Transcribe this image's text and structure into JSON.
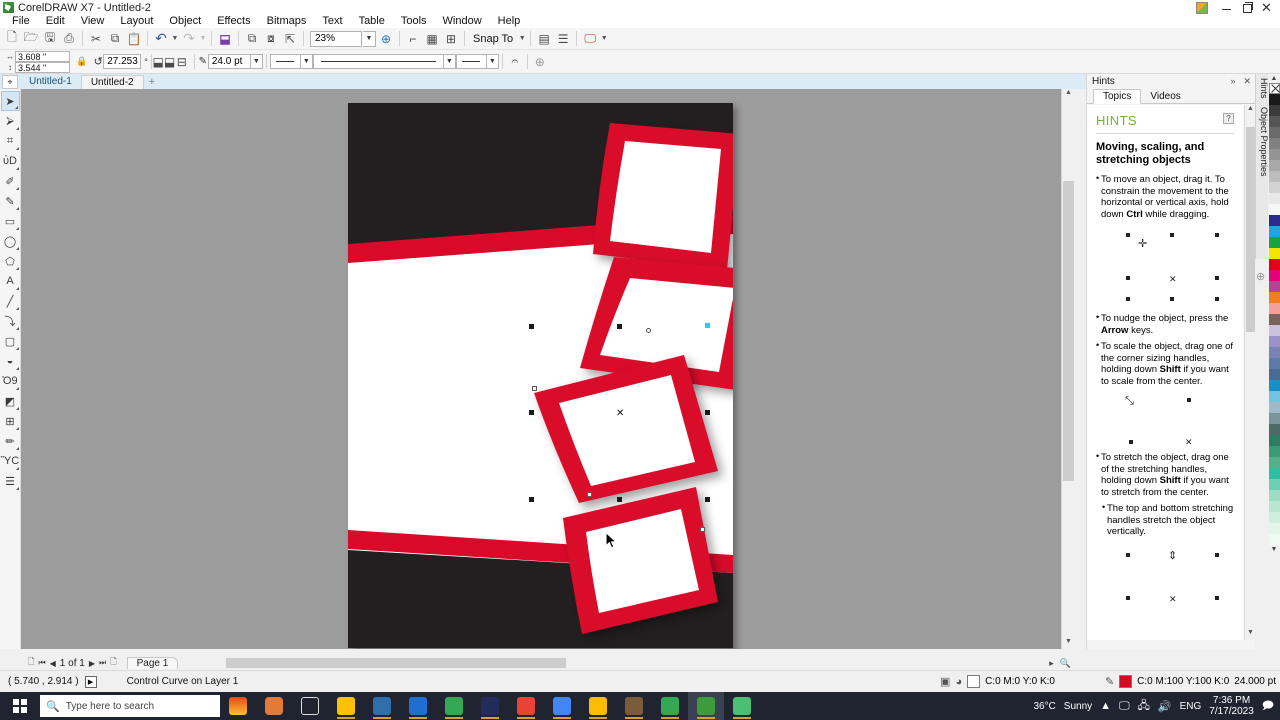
{
  "window": {
    "title": "CorelDRAW X7 - Untitled-2",
    "app_icon": "coreldraw-icon",
    "minimize": "–",
    "maximize": "❐",
    "close": "✕"
  },
  "menubar": {
    "items": [
      "File",
      "Edit",
      "View",
      "Layout",
      "Object",
      "Effects",
      "Bitmaps",
      "Text",
      "Table",
      "Tools",
      "Window",
      "Help"
    ]
  },
  "toolbar": {
    "zoom_level": "23%",
    "snap_to_label": "Snap To",
    "buttons": [
      {
        "name": "new-document",
        "glyph": "὜B"
      },
      {
        "name": "open-document",
        "glyph": "὜1"
      },
      {
        "name": "save-document",
        "glyph": "ὋE"
      },
      {
        "name": "print",
        "glyph": "⎙"
      },
      {
        "name": "cut",
        "glyph": "✂"
      },
      {
        "name": "copy",
        "glyph": "⧉"
      },
      {
        "name": "paste",
        "glyph": "ὌB"
      },
      {
        "name": "undo",
        "glyph": "↶"
      },
      {
        "name": "redo",
        "glyph": "↷"
      },
      {
        "name": "import",
        "glyph": "⬇"
      },
      {
        "name": "export",
        "glyph": "⬆"
      },
      {
        "name": "publish-pdf",
        "glyph": "⧉"
      },
      {
        "name": "application-launcher",
        "glyph": "⊕"
      },
      {
        "name": "full-screen-preview",
        "glyph": "⌷"
      },
      {
        "name": "show-rulers",
        "glyph": "▤"
      },
      {
        "name": "show-grid",
        "glyph": "⊞"
      },
      {
        "name": "options",
        "glyph": "⚙"
      }
    ]
  },
  "propertybar": {
    "width_value": "3.608 \"",
    "height_value": "3.544 \"",
    "lock_ratio_icon": "lock-icon",
    "rotation_value": "27.253",
    "rotation_unit": "°",
    "outline_width_value": "24.0 pt",
    "mirror_h_icon": "mirror-horizontal-icon",
    "mirror_v_icon": "mirror-vertical-icon",
    "outline_icon": "outline-pen-icon",
    "wrap_text_icon": "wrap-text-icon",
    "edit_bitmap_icon": "edit-bitmap-icon"
  },
  "doc_tabs": {
    "tabs": [
      {
        "label": "Untitled-1",
        "active": false
      },
      {
        "label": "Untitled-2",
        "active": true
      }
    ],
    "add_label": "+"
  },
  "toolbox": {
    "tools": [
      {
        "name": "pick-tool",
        "glyph": "➤",
        "selected": true
      },
      {
        "name": "shape-tool",
        "glyph": "⮚",
        "selected": false
      },
      {
        "name": "crop-tool",
        "glyph": "⌗",
        "selected": false
      },
      {
        "name": "zoom-tool",
        "glyph": "ὐD",
        "selected": false
      },
      {
        "name": "freehand-tool",
        "glyph": "✐",
        "selected": false
      },
      {
        "name": "smart-fill-tool",
        "glyph": "✎",
        "selected": false
      },
      {
        "name": "rectangle-tool",
        "glyph": "▭",
        "selected": false
      },
      {
        "name": "ellipse-tool",
        "glyph": "◯",
        "selected": false
      },
      {
        "name": "polygon-tool",
        "glyph": "⬠",
        "selected": false
      },
      {
        "name": "text-tool",
        "glyph": "A",
        "selected": false
      },
      {
        "name": "parallel-dimension-tool",
        "glyph": "╱",
        "selected": false
      },
      {
        "name": "straight-line-connector-tool",
        "glyph": "⤵",
        "selected": false
      },
      {
        "name": "drop-shadow-tool",
        "glyph": "▢",
        "selected": false
      },
      {
        "name": "transparency-tool",
        "glyph": "◒",
        "selected": false
      },
      {
        "name": "color-eyedropper-tool",
        "glyph": "Ὀ9",
        "selected": false
      },
      {
        "name": "interactive-fill-tool",
        "glyph": "◩",
        "selected": false
      },
      {
        "name": "mesh-fill-tool",
        "glyph": "⊞",
        "selected": false
      },
      {
        "name": "smart-drawing-tool",
        "glyph": "✏",
        "selected": false
      },
      {
        "name": "import-image-tool",
        "glyph": "ὛC",
        "selected": false
      },
      {
        "name": "outline-color-tool",
        "glyph": "☰",
        "selected": false
      }
    ]
  },
  "canvas": {
    "artwork_name": "red-frames-poster",
    "colors": {
      "black_band": "#231f20",
      "red": "#d9092a",
      "white": "#ffffff",
      "canvas_bg": "#9c9c9c"
    },
    "selection_handle_color": "#1a1a1a",
    "node_highlight_color": "#22d3ee"
  },
  "pagenav": {
    "first_icon": "⏮",
    "prev_icon": "◀",
    "page_counter": "1 of 1",
    "next_icon": "▶",
    "last_icon": "⏭",
    "add_page_icon": "὜B",
    "page_tab_label": "Page 1"
  },
  "statusbar": {
    "coordinates": "( 5.740 , 2.914 )",
    "object_info": "Control Curve on Layer 1",
    "fill_label": "C:0 M:0 Y:0 K:0",
    "outline_label": "C:0 M:100 Y:100 K:0",
    "outline_width": "24.000 pt",
    "fill_swatch": "#ffffff",
    "outline_swatch": "#d40a22"
  },
  "docker": {
    "title": "Hints",
    "collapse_icon": "»",
    "close_icon": "✕",
    "tabs": [
      {
        "label": "Topics",
        "active": true
      },
      {
        "label": "Videos",
        "active": false
      }
    ],
    "panel_heading": "HINTS",
    "help_badge": "?",
    "topic_title": "Moving, scaling, and stretching objects",
    "hints": [
      {
        "text": "To move an object, drag it. To constrain the movement to the horizontal or vertical axis, hold down ",
        "bold": "Ctrl",
        "tail": " while dragging.",
        "indent": false
      },
      {
        "text": "To nudge the object, press the ",
        "bold": "Arrow",
        "tail": " keys.",
        "indent": false
      },
      {
        "text": "To scale the object, drag one of the corner sizing handles, holding down ",
        "bold": "Shift",
        "tail": " if you want to scale from the center.",
        "indent": false
      },
      {
        "text": "To stretch the object, drag one of the stretching handles, holding down ",
        "bold": "Shift",
        "tail": " if you want to stretch from the center.",
        "indent": false
      },
      {
        "text": "The top and bottom stretching handles stretch the object vertically.",
        "bold": "",
        "tail": "",
        "indent": true
      }
    ],
    "side_tabs": [
      {
        "label": "Hints",
        "icon": "hints-icon"
      },
      {
        "label": "Object Properties",
        "icon": "object-properties-icon"
      }
    ],
    "add_docker_icon": "⊕"
  },
  "palette": {
    "scroll_up": "▲",
    "scroll_down": "▼",
    "no_color_name": "no-color-swatch",
    "swatches": [
      "#1a1a1a",
      "#3a3a3a",
      "#555555",
      "#6b6b6b",
      "#808080",
      "#949494",
      "#a8a8a8",
      "#bdbdbd",
      "#d2d2d2",
      "#e8e8e8",
      "#f7f7f7",
      "#2b2b8f",
      "#1aa8d6",
      "#17a33f",
      "#f2e500",
      "#e3001b",
      "#e5007d",
      "#b44592",
      "#ef7d22",
      "#f4a09a",
      "#7a635a",
      "#c9c3df",
      "#9a92c8",
      "#7b82b6",
      "#5e7aa8",
      "#4a6b96",
      "#1a8fc4",
      "#71c3e0",
      "#9fb9c8",
      "#7c949c",
      "#4d6b66",
      "#2e7d63",
      "#3c9a78",
      "#55b08a",
      "#2fbfa0",
      "#6dcfb4",
      "#9adcc4",
      "#b9e6d2",
      "#cfeede",
      "#e3f4ea",
      "#f0faf4"
    ]
  },
  "taskbar": {
    "search_placeholder": "Type here to search",
    "search_icon": "search-icon",
    "start_icon": "windows-start-icon",
    "task_view_icon": "task-view-icon",
    "pinned": [
      {
        "name": "file-explorer",
        "color": "#ffc107"
      },
      {
        "name": "microsoft-store",
        "color": "#2f6fab"
      },
      {
        "name": "mail",
        "color": "#1f6fd0"
      },
      {
        "name": "google-chrome",
        "color": "#34a853"
      },
      {
        "name": "photoshop",
        "color": "#222b5c"
      },
      {
        "name": "chrome-profile-1",
        "color": "#ea4335"
      },
      {
        "name": "chrome-profile-2",
        "color": "#4285f4"
      },
      {
        "name": "chrome-profile-3",
        "color": "#fbbc05"
      },
      {
        "name": "mouse-tool",
        "color": "#7a5c3a"
      },
      {
        "name": "chrome-profile-4",
        "color": "#34a853"
      },
      {
        "name": "coreldraw",
        "color": "#3c9c3c"
      },
      {
        "name": "corel-photo-paint",
        "color": "#4bbf73"
      }
    ],
    "weather_temp": "36°C",
    "weather_desc": "Sunny",
    "tray_icons": [
      "▲",
      "὚5",
      "὚B",
      "ὐA"
    ],
    "language": "ENG",
    "time": "7:36 PM",
    "date": "7/17/2023",
    "action_center_icon": "notifications-icon"
  }
}
